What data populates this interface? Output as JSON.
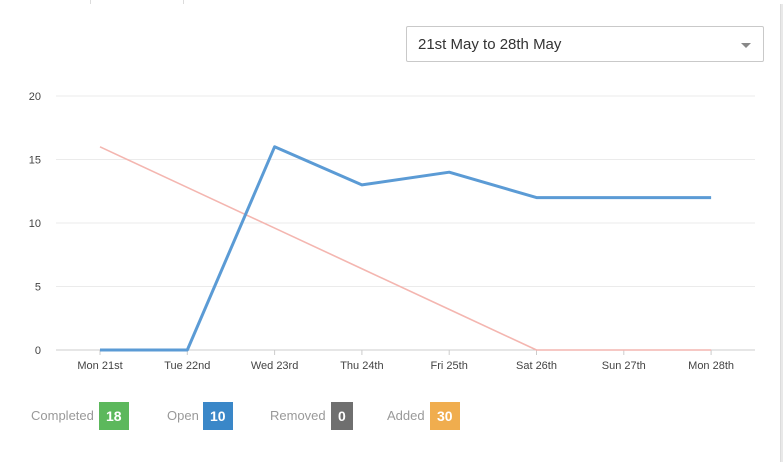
{
  "date_range": {
    "selected": "21st May to 28th May"
  },
  "chart_data": {
    "type": "line",
    "categories": [
      "Mon 21st",
      "Tue 22nd",
      "Wed 23rd",
      "Thu 24th",
      "Fri 25th",
      "Sat 26th",
      "Sun 27th",
      "Mon 28th"
    ],
    "ylim": [
      0,
      20
    ],
    "yticks": [
      0,
      5,
      10,
      15,
      20
    ],
    "grid": true,
    "series": [
      {
        "color": "#5b9bd5",
        "values": [
          0,
          0,
          16,
          13,
          14,
          12,
          12,
          12
        ]
      },
      {
        "color": "#f4b6b0",
        "values": [
          16,
          12.8,
          9.6,
          6.4,
          3.2,
          0,
          0,
          0
        ]
      }
    ]
  },
  "legend": [
    {
      "label": "Completed",
      "count": "18",
      "color": "#5cb85c"
    },
    {
      "label": "Open",
      "count": "10",
      "color": "#3a87c8"
    },
    {
      "label": "Removed",
      "count": "0",
      "color": "#6f6f6f"
    },
    {
      "label": "Added",
      "count": "30",
      "color": "#f0ad4e"
    }
  ]
}
